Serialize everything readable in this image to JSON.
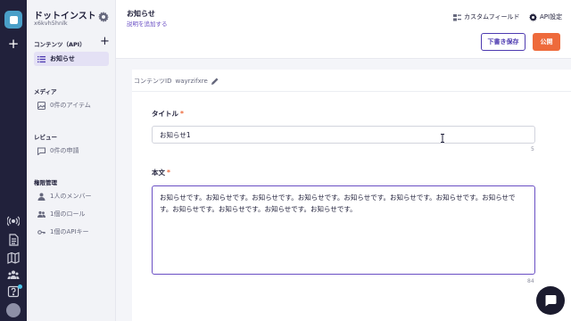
{
  "sidebar": {
    "title": "ドットインスト…",
    "subtitle": "x6kvh5hnlk",
    "contents_header": "コンテンツ（API）",
    "contents_items": [
      {
        "label": "お知らせ",
        "icon": "list-icon"
      }
    ],
    "media_header": "メディア",
    "media_items": [
      {
        "label": "0件のアイテム",
        "icon": "image-icon"
      }
    ],
    "review_header": "レビュー",
    "review_items": [
      {
        "label": "0件の申請",
        "icon": "comment-icon"
      }
    ],
    "perm_header": "権限管理",
    "perm_items": [
      {
        "label": "1人のメンバー",
        "icon": "user-icon"
      },
      {
        "label": "1個のロール",
        "icon": "group-icon"
      },
      {
        "label": "1個のAPIキー",
        "icon": "key-icon"
      }
    ]
  },
  "header": {
    "title": "お知らせ",
    "subtitle": "説明を追加する",
    "custom_field": "カスタムフィールド",
    "api_settings": "API設定",
    "draft_button": "下書き保存",
    "publish_button": "公開"
  },
  "form": {
    "content_id_label": "コンテンツID",
    "content_id_value": "wayrzifxre",
    "title_label": "タイトル",
    "required_mark": "*",
    "title_value": "お知らせ1",
    "title_count": "5",
    "body_label": "本文",
    "body_value": "お知らせです。お知らせです。お知らせです。お知らせです。お知らせです。お知らせです。お知らせです。お知らせです。お知らせです。お知らせです。お知らせです。お知らせです。",
    "body_count": "84"
  },
  "colors": {
    "rail": "#21213b",
    "accent": "#4d3ab0",
    "publish": "#ee6a3b"
  }
}
